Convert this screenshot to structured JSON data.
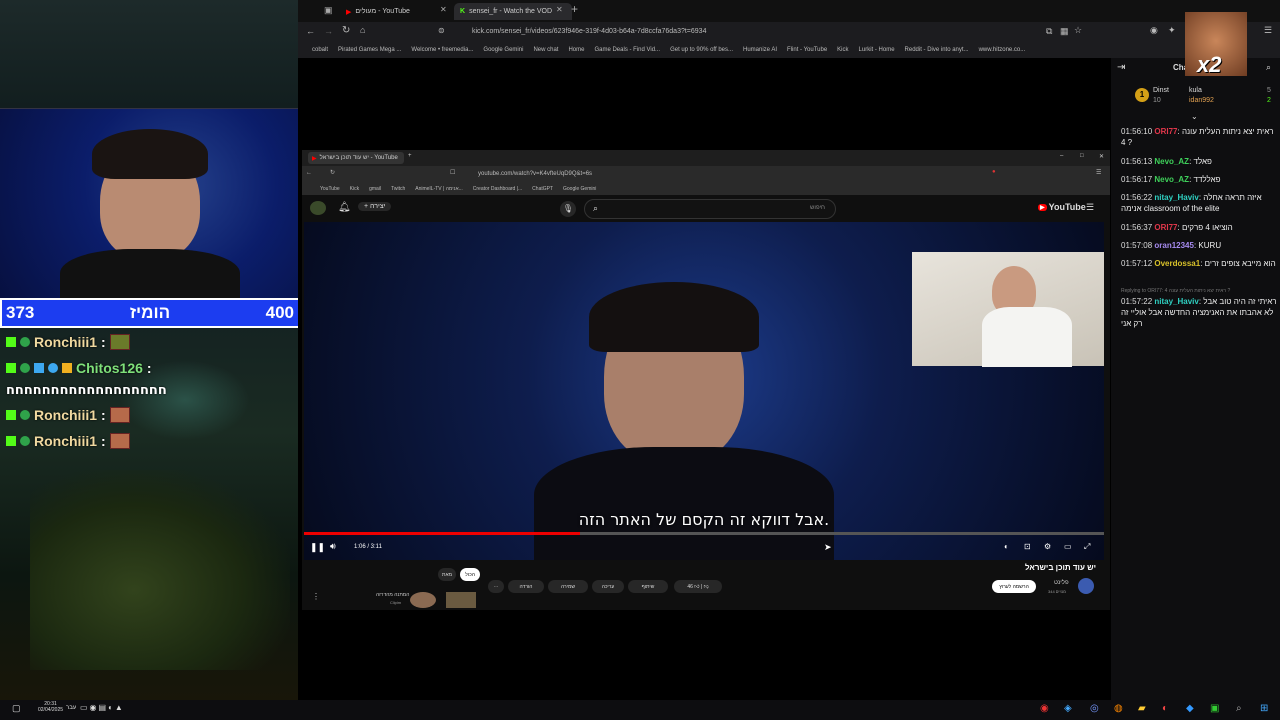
{
  "browser": {
    "tabs": [
      {
        "label": "מעולים - YouTube",
        "active": false
      },
      {
        "label": "sensei_fr - Watch the VOD",
        "active": true
      }
    ],
    "url": "kick.com/sensei_fr/videos/623f946e-319f-4d03-b64a-7d8ccfa76da3?t=6934",
    "bookmarks": [
      "cobalt",
      "Pirated Games Mega ...",
      "Welcome • freemedia...",
      "Google Gemini",
      "New chat",
      "Home",
      "Game Deals - Find Vid...",
      "Get up to 90% off bes...",
      "Humanize AI",
      "Flint - YouTube",
      "Kick",
      "Lurkit - Home",
      "Reddit - Dive into anyt...",
      "www.hitzone.co..."
    ]
  },
  "stream": {
    "score": {
      "left": "373",
      "title": "הומיז",
      "right": "400"
    },
    "chat": [
      {
        "user": "Ronchiii1",
        "sep": ":",
        "text": ""
      },
      {
        "user": "Chitos126",
        "sep": ":",
        "text": "חחחחחחחחחחחחחחחחחח"
      },
      {
        "user": "Ronchiii1",
        "sep": ":",
        "text": ""
      },
      {
        "user": "Ronchiii1",
        "sep": ":",
        "text": ""
      }
    ]
  },
  "inner_browser": {
    "tab": "יש עוד תוכן בישראל - YouTube",
    "url": "youtube.com/watch?v=K4vfteUqD9Q&t=6s",
    "bookmarks": [
      "YouTube",
      "Kick",
      "gmail",
      "Twitch",
      "AnimeIL-TV | אנימה...",
      "Creator Dashboard |...",
      "ChatGPT",
      "Google Gemini"
    ],
    "create_label": "יצירה",
    "search_placeholder": "חיפוש",
    "yt_logo": "YouTube",
    "subtitle": "אבל דווקא זה הקסם של האתר הזה.",
    "time": "1:06 / 3:11",
    "progress": 0.345,
    "video_title": "יש עוד תוכן בישראל",
    "channel": "פלינט",
    "subs": "344 מנויים",
    "subscribe": "הרשמה לערוץ",
    "likes": "46",
    "actions": [
      "שיתוף",
      "עריכה",
      "שמירה",
      "הורדה"
    ],
    "chips": [
      "הכול",
      "מאת"
    ],
    "related_title": "המתנה מהדרזה",
    "related_channel": "Clipim"
  },
  "right_chat": {
    "title": "Chat",
    "pinned": [
      {
        "rank": "1",
        "name": "Dinst",
        "count": "10"
      },
      {
        "name": "kula",
        "count": "5"
      },
      {
        "name": "idan992",
        "count": "2"
      }
    ],
    "messages": [
      {
        "time": "01:56:10",
        "user": "ORI77",
        "color": "#e0364a",
        "text": "ראית יצא ניתות העלית עונה 4 ?"
      },
      {
        "time": "01:56:13",
        "user": "Nevo_AZ",
        "color": "#3ed05a",
        "text": "פאלד"
      },
      {
        "time": "01:56:17",
        "user": "Nevo_AZ",
        "color": "#3ed05a",
        "text": "פאללדד"
      },
      {
        "time": "01:56:22",
        "user": "nitay_Haviv",
        "color": "#2fd1c2",
        "text": "איזה תראה אחלה אנימה classroom of the elite"
      },
      {
        "time": "01:56:37",
        "user": "ORI77",
        "color": "#e0364a",
        "text": "הוציאו 4 פרקים"
      },
      {
        "time": "01:57:08",
        "user": "oran12345",
        "color": "#a68bf0",
        "text": "KURU"
      },
      {
        "time": "01:57:12",
        "user": "Overdossa1",
        "color": "#d8c12a",
        "text": "הוא מייבא צופים זרים"
      },
      {
        "time": "01:57:22",
        "user": "nitay_Haviv",
        "color": "#2fd1c2",
        "text": "ראיתי זה היה טוב אבל לא אהבתו את האנימציה החדשה אבל אוליי זה רק אני"
      }
    ],
    "reply_note": "Replying to ORI77: ראית יצא ניתות העלית עונה 4 ?",
    "overlay": "x2"
  },
  "taskbar": {
    "time": "20:31",
    "date": "02/04/2025",
    "lang": "עבר"
  }
}
